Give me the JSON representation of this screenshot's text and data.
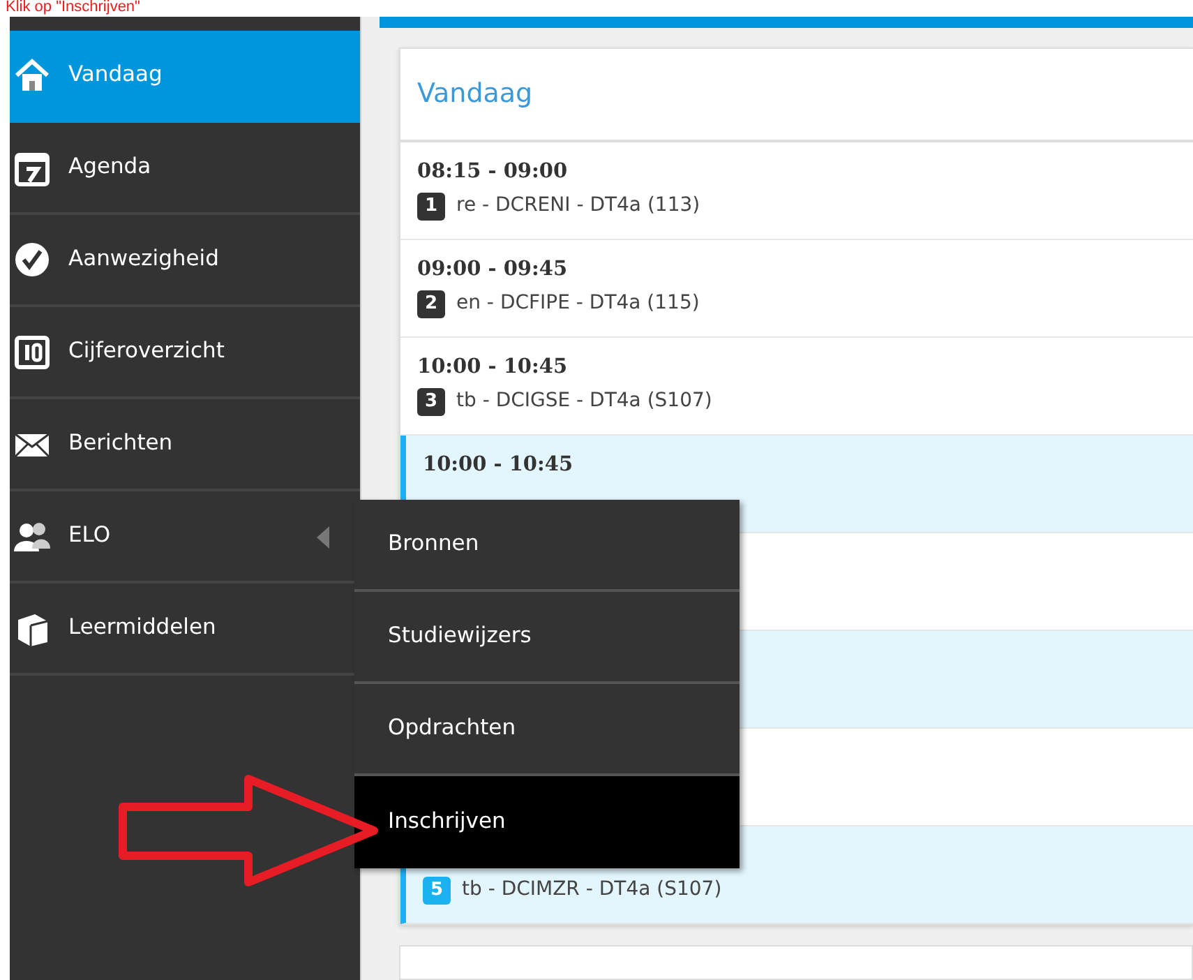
{
  "annotation": {
    "text": "Klik op \"Inschrijven\""
  },
  "sidebar": {
    "items": [
      {
        "label": "Vandaag",
        "selected": true
      },
      {
        "label": "Agenda",
        "selected": false
      },
      {
        "label": "Aanwezigheid",
        "selected": false
      },
      {
        "label": "Cijferoverzicht",
        "selected": false
      },
      {
        "label": "Berichten",
        "selected": false
      },
      {
        "label": "ELO",
        "selected": false,
        "submenu": [
          {
            "label": "Bronnen",
            "selected": false
          },
          {
            "label": "Studiewijzers",
            "selected": false
          },
          {
            "label": "Opdrachten",
            "selected": false
          },
          {
            "label": "Inschrijven",
            "selected": true
          }
        ]
      },
      {
        "label": "Leermiddelen",
        "selected": false
      }
    ]
  },
  "today": {
    "title": "Vandaag",
    "rows": [
      {
        "time": "08:15 - 09:00",
        "hour": "1",
        "lesson": "re - DCRENI - DT4a (113)",
        "highlighted": false
      },
      {
        "time": "09:00 - 09:45",
        "hour": "2",
        "lesson": "en - DCFIPE - DT4a (115)",
        "highlighted": false
      },
      {
        "time": "10:00 - 10:45",
        "hour": "3",
        "lesson": "tb - DCIGSE - DT4a (S107)",
        "highlighted": false
      },
      {
        "time": "10:00 - 10:45",
        "highlighted": true
      },
      {
        "highlighted": false
      },
      {
        "highlighted": true
      },
      {
        "highlighted": false
      },
      {
        "hour": "5",
        "lesson": "tb - DCIMZR - DT4a (S107)",
        "highlighted": true
      }
    ]
  }
}
